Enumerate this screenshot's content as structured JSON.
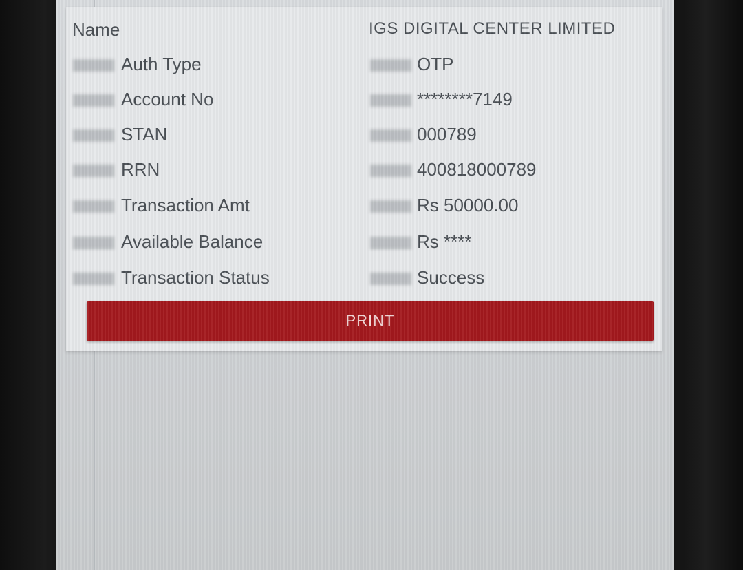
{
  "receipt": {
    "rows": [
      {
        "label": "Name",
        "value": "IGS DIGITAL CENTER LIMITED"
      },
      {
        "label": "Auth Type",
        "value": "OTP"
      },
      {
        "label": "Account No",
        "value": "********7149"
      },
      {
        "label": "STAN",
        "value": "000789"
      },
      {
        "label": "RRN",
        "value": "400818000789"
      },
      {
        "label": "Transaction Amt",
        "value": "Rs 50000.00"
      },
      {
        "label": "Available Balance",
        "value": "Rs ****"
      },
      {
        "label": "Transaction Status",
        "value": "Success"
      }
    ]
  },
  "actions": {
    "print_label": "PRINT"
  },
  "colors": {
    "print_button": "#a3191e",
    "screen_background": "#d9dcdf",
    "text": "#4a4f55"
  }
}
